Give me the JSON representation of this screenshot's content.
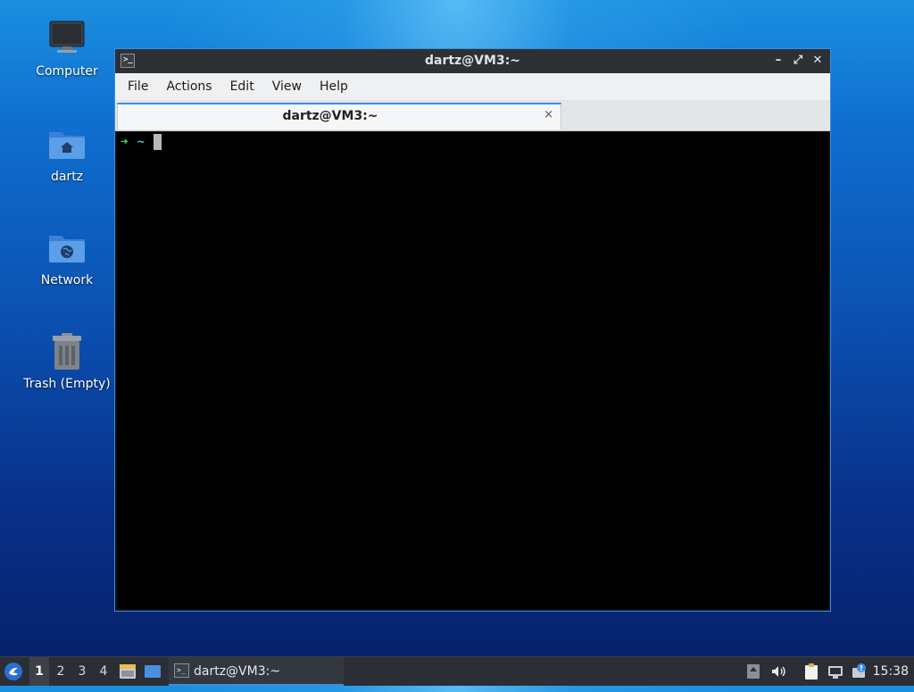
{
  "desktop": {
    "icons": [
      {
        "label": "Computer",
        "icon": "monitor-icon"
      },
      {
        "label": "dartz",
        "icon": "home-folder-icon"
      },
      {
        "label": "Network",
        "icon": "network-folder-icon"
      },
      {
        "label": "Trash (Empty)",
        "icon": "trash-icon"
      }
    ]
  },
  "window": {
    "title": "dartz@VM3:~",
    "menu": [
      "File",
      "Actions",
      "Edit",
      "View",
      "Help"
    ],
    "tab": {
      "label": "dartz@VM3:~",
      "close": "×"
    },
    "terminal": {
      "prompt_arrow": "➜",
      "prompt_dir": "~"
    },
    "controls": {
      "minimize": "–",
      "maximize": "⤢",
      "close": "✕"
    }
  },
  "taskbar": {
    "workspaces": [
      "1",
      "2",
      "3",
      "4"
    ],
    "active_workspace": "1",
    "task_title": "dartz@VM3:~",
    "clock": "15:38"
  },
  "colors": {
    "accent": "#3a8ee6",
    "prompt_arrow": "#3fe04a",
    "prompt_dir": "#32c8c8"
  }
}
